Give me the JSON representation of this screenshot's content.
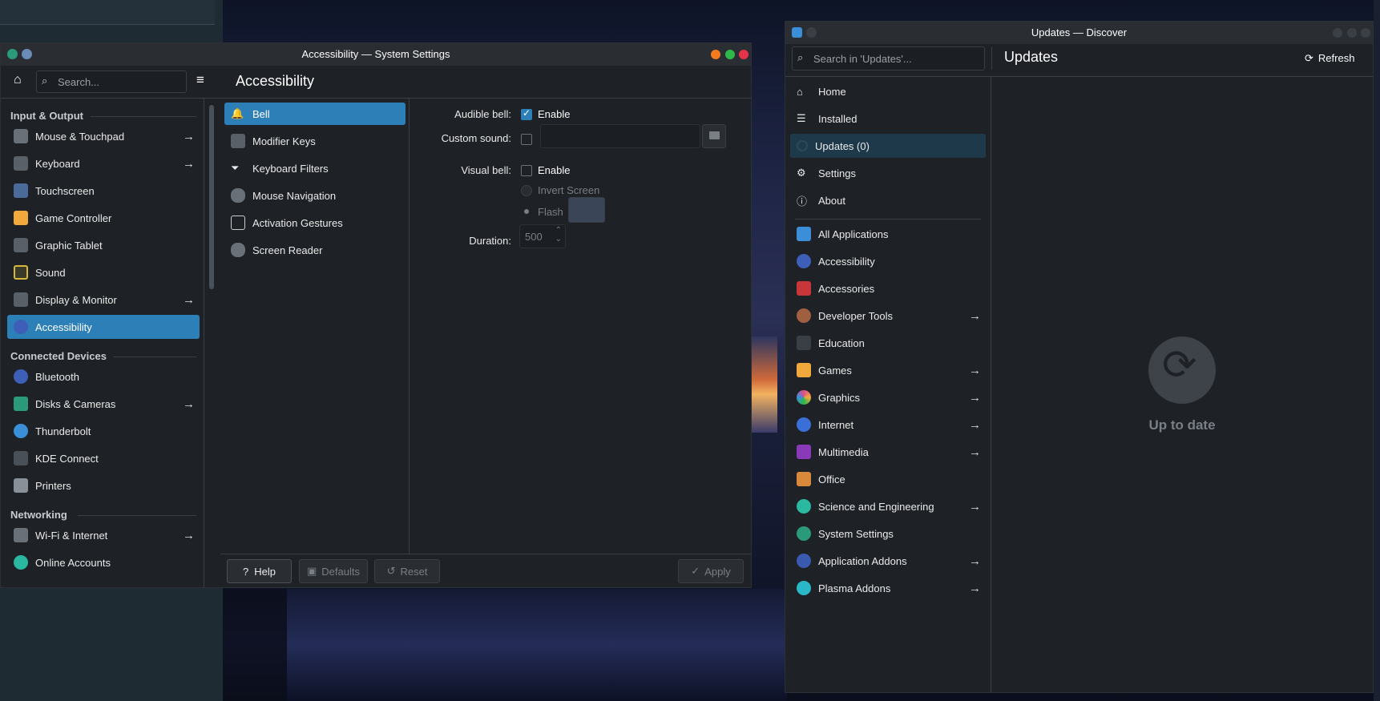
{
  "settings": {
    "title": "Accessibility — System Settings",
    "search_placeholder": "Search...",
    "page_title": "Accessibility",
    "sections": [
      {
        "label": "Input & Output",
        "items": [
          {
            "label": "Mouse & Touchpad",
            "arrow": true
          },
          {
            "label": "Keyboard",
            "arrow": true
          },
          {
            "label": "Touchscreen",
            "arrow": false
          },
          {
            "label": "Game Controller",
            "arrow": false
          },
          {
            "label": "Graphic Tablet",
            "arrow": false
          },
          {
            "label": "Sound",
            "arrow": false
          },
          {
            "label": "Display & Monitor",
            "arrow": true
          },
          {
            "label": "Accessibility",
            "arrow": false
          }
        ]
      },
      {
        "label": "Connected Devices",
        "items": [
          {
            "label": "Bluetooth",
            "arrow": false
          },
          {
            "label": "Disks & Cameras",
            "arrow": true
          },
          {
            "label": "Thunderbolt",
            "arrow": false
          },
          {
            "label": "KDE Connect",
            "arrow": false
          },
          {
            "label": "Printers",
            "arrow": false
          }
        ]
      },
      {
        "label": "Networking",
        "items": [
          {
            "label": "Wi-Fi & Internet",
            "arrow": true
          },
          {
            "label": "Online Accounts",
            "arrow": false
          }
        ]
      }
    ],
    "sub_items": [
      "Bell",
      "Modifier Keys",
      "Keyboard Filters",
      "Mouse Navigation",
      "Activation Gestures",
      "Screen Reader"
    ],
    "form": {
      "audible_bell_label": "Audible bell:",
      "enable_label": "Enable",
      "custom_sound_label": "Custom sound:",
      "visual_bell_label": "Visual bell:",
      "visual_enable_label": "Enable",
      "invert_screen_label": "Invert Screen",
      "flash_label": "Flash",
      "duration_label": "Duration:",
      "duration_value": "500"
    },
    "buttons": {
      "help": "Help",
      "defaults": "Defaults",
      "reset": "Reset",
      "apply": "Apply"
    }
  },
  "discover": {
    "title": "Updates — Discover",
    "search_placeholder": "Search in 'Updates'...",
    "page_title": "Updates",
    "refresh_label": "Refresh",
    "nav": [
      "Home",
      "Installed",
      "Updates (0)",
      "Settings",
      "About"
    ],
    "categories": [
      {
        "label": "All Applications",
        "arrow": false,
        "color": "#3a8fd8"
      },
      {
        "label": "Accessibility",
        "arrow": false,
        "color": "#3e5fb8"
      },
      {
        "label": "Accessories",
        "arrow": false,
        "color": "#c8363a"
      },
      {
        "label": "Developer Tools",
        "arrow": true,
        "color": "#a06040"
      },
      {
        "label": "Education",
        "arrow": false,
        "color": "#3a3f46"
      },
      {
        "label": "Games",
        "arrow": true,
        "color": "#f2a93b"
      },
      {
        "label": "Graphics",
        "arrow": true,
        "color": "#e04a8a"
      },
      {
        "label": "Internet",
        "arrow": true,
        "color": "#3a6fd8"
      },
      {
        "label": "Multimedia",
        "arrow": true,
        "color": "#8a3ab8"
      },
      {
        "label": "Office",
        "arrow": false,
        "color": "#d88a3a"
      },
      {
        "label": "Science and Engineering",
        "arrow": true,
        "color": "#2ab8a0"
      },
      {
        "label": "System Settings",
        "arrow": false,
        "color": "#2a9a7a"
      },
      {
        "label": "Application Addons",
        "arrow": true,
        "color": "#3a5ab0"
      },
      {
        "label": "Plasma Addons",
        "arrow": true,
        "color": "#2ab8c8"
      }
    ],
    "status": "Up to date"
  }
}
